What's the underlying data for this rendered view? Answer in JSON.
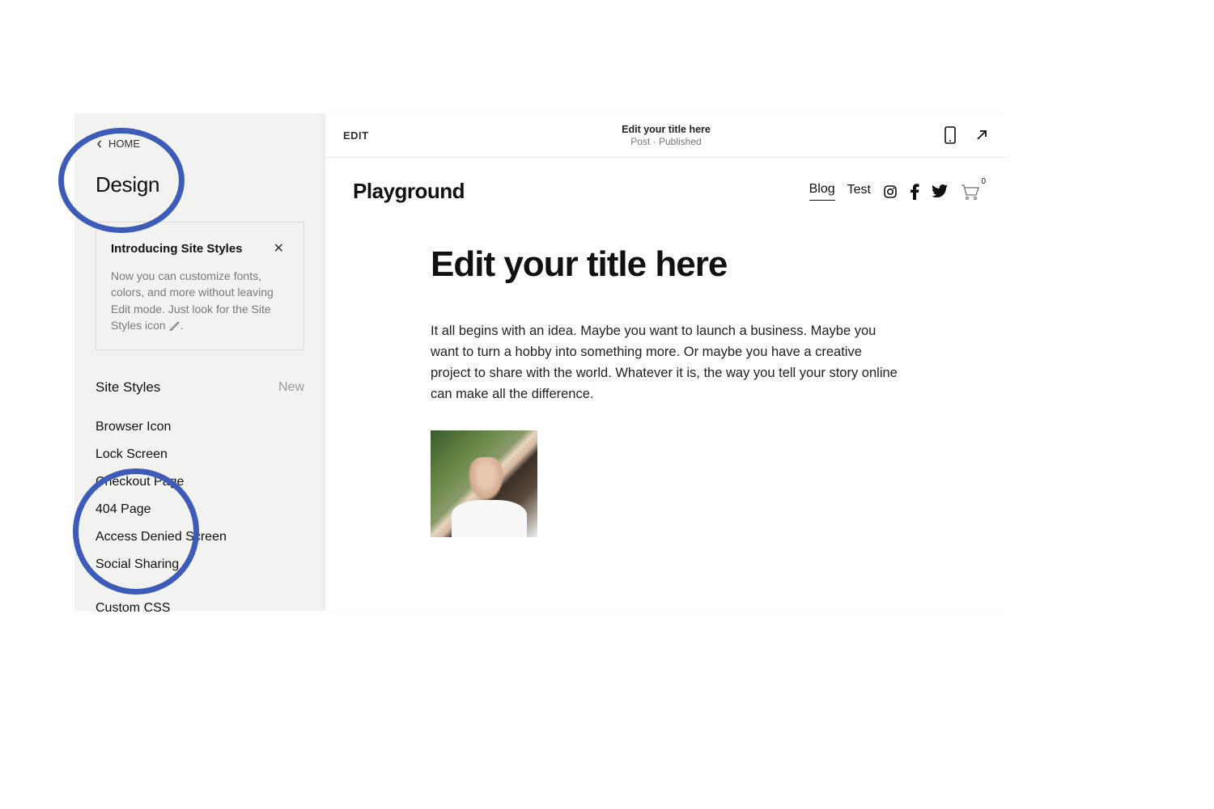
{
  "sidebar": {
    "back_label": "HOME",
    "title": "Design",
    "intro": {
      "title": "Introducing Site Styles",
      "body_pre": "Now you can customize fonts, colors, and more without leaving Edit mode. Just look for the Site Styles icon ",
      "body_post": "."
    },
    "site_styles_label": "Site Styles",
    "site_styles_badge": "New",
    "items": [
      "Browser Icon",
      "Lock Screen",
      "Checkout Page",
      "404 Page",
      "Access Denied Screen",
      "Social Sharing"
    ],
    "custom_css_label": "Custom CSS"
  },
  "toolbar": {
    "edit_label": "EDIT",
    "title": "Edit your title here",
    "subtitle": "Post · Published"
  },
  "site": {
    "name": "Playground",
    "nav": {
      "blog": "Blog",
      "test": "Test"
    },
    "cart_count": "0"
  },
  "post": {
    "title": "Edit your title here",
    "body": "It all begins with an idea. Maybe you want to launch a business. Maybe you want to turn a hobby into something more. Or maybe you have a creative project to share with the world. Whatever it is, the way you tell your story online can make all the difference."
  }
}
